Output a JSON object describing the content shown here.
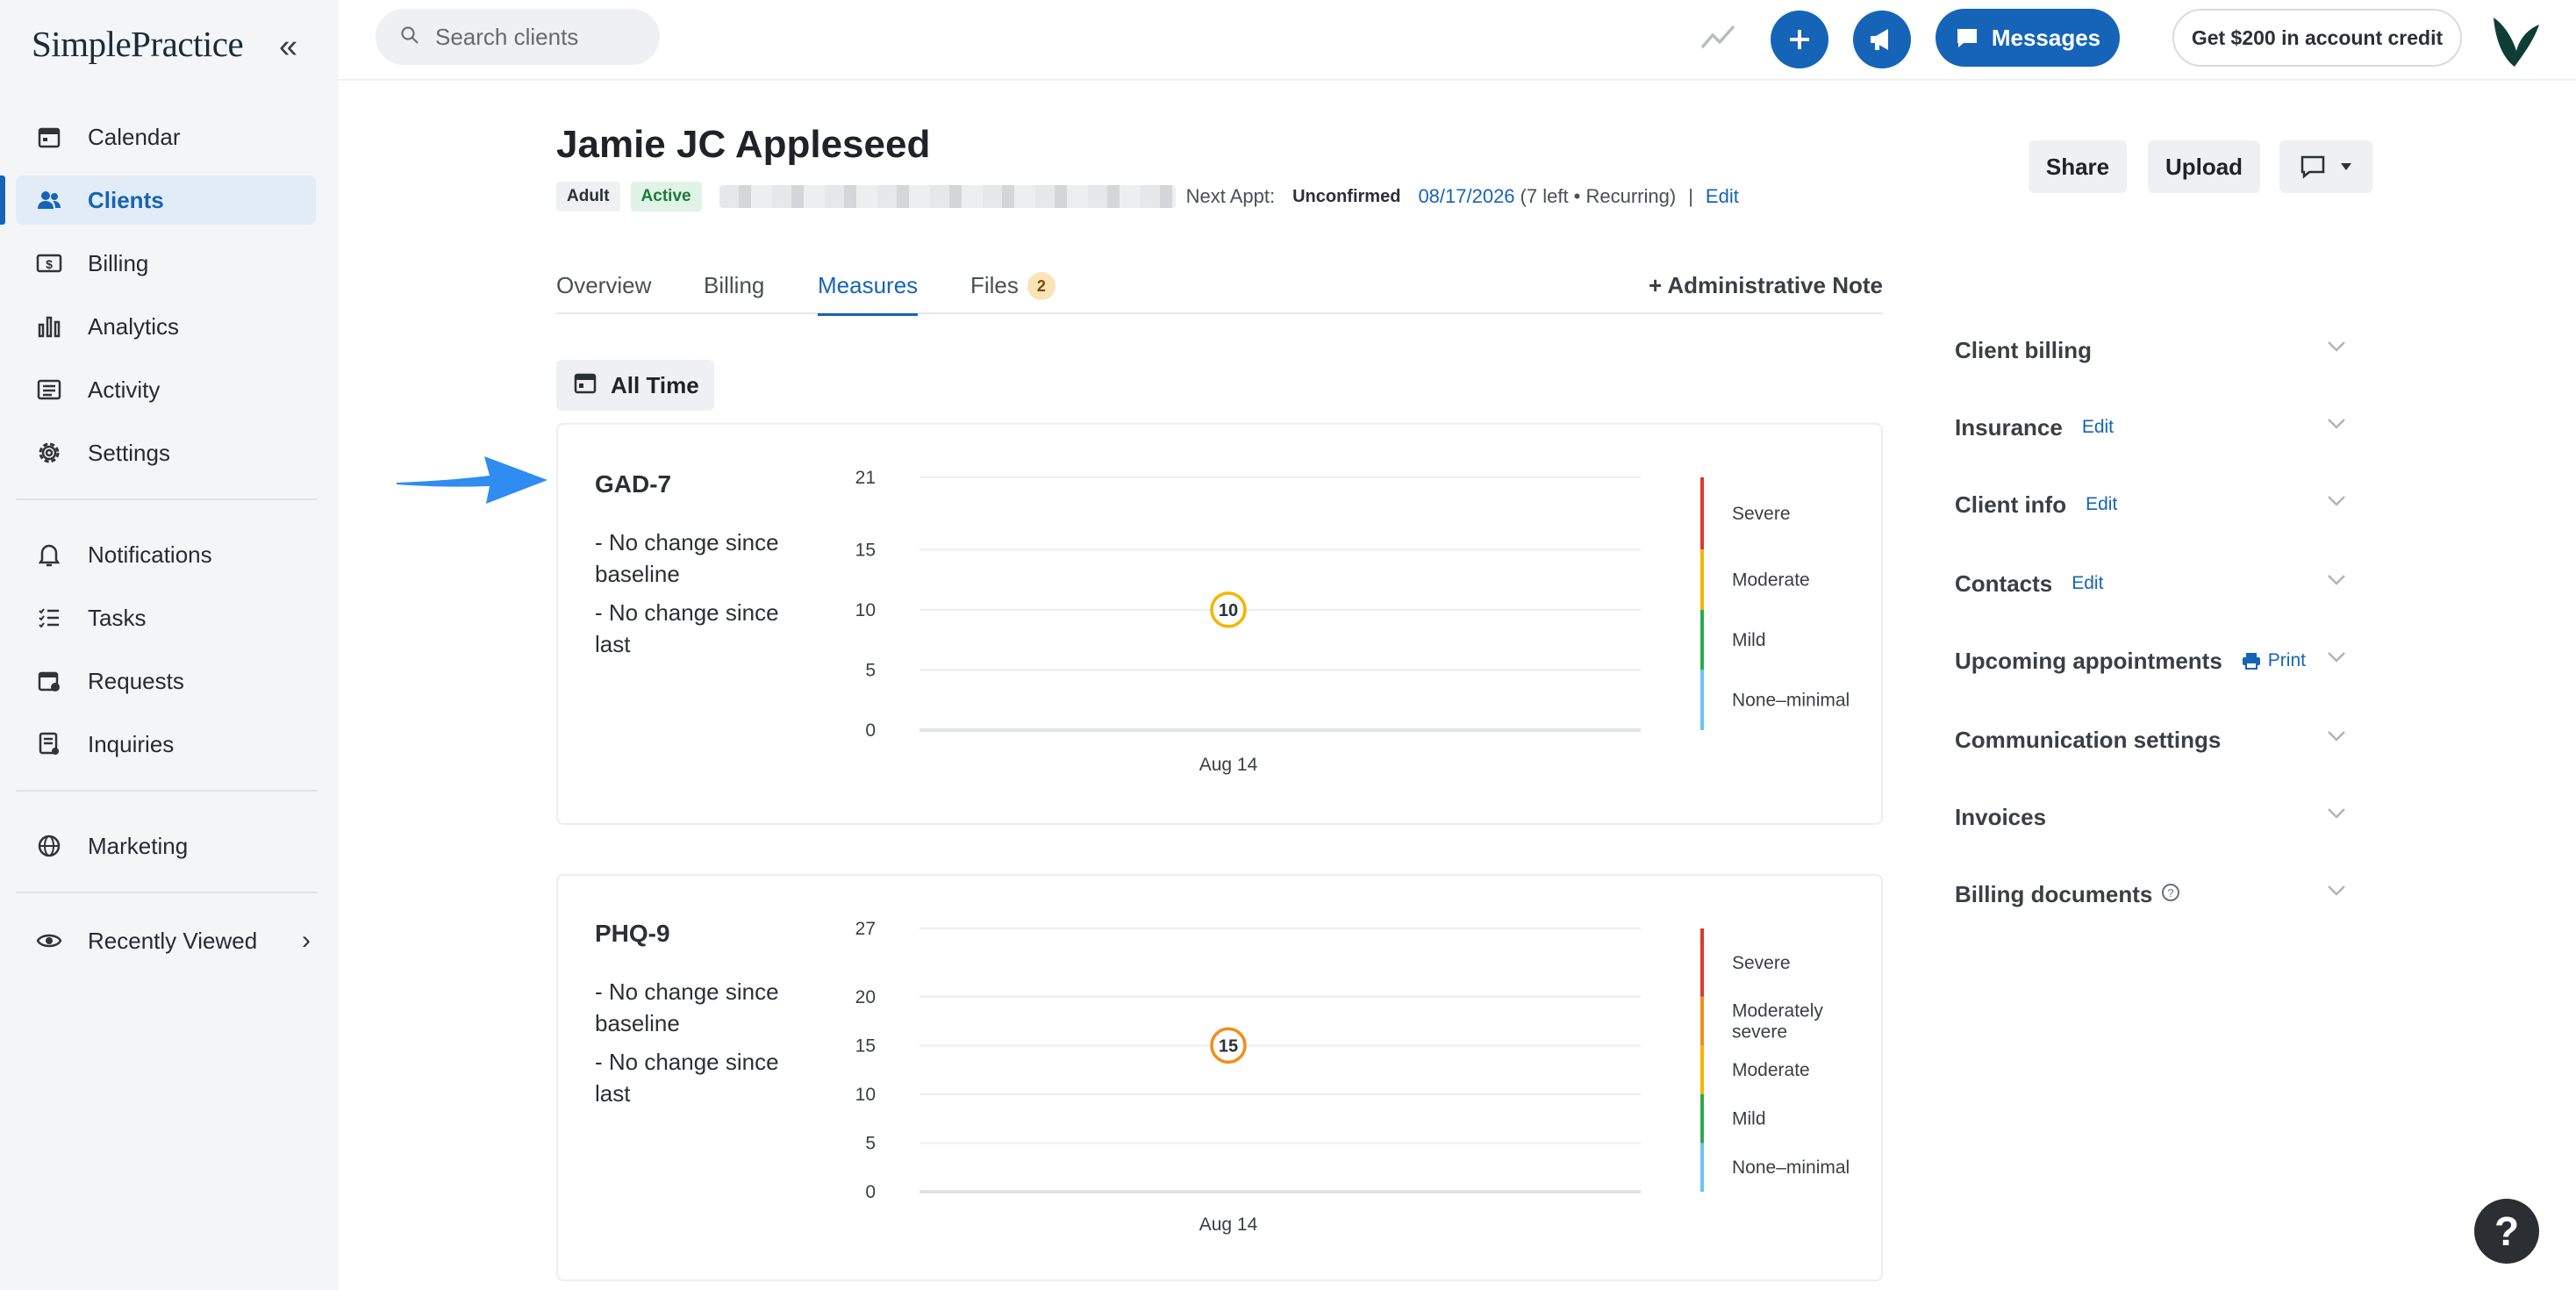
{
  "app": {
    "logo": "SimplePractice"
  },
  "sidebar": {
    "items": [
      {
        "label": "Calendar"
      },
      {
        "label": "Clients"
      },
      {
        "label": "Billing"
      },
      {
        "label": "Analytics"
      },
      {
        "label": "Activity"
      },
      {
        "label": "Settings"
      },
      {
        "label": "Notifications"
      },
      {
        "label": "Tasks"
      },
      {
        "label": "Requests"
      },
      {
        "label": "Inquiries"
      },
      {
        "label": "Marketing"
      },
      {
        "label": "Recently Viewed"
      }
    ],
    "active": "Clients"
  },
  "topbar": {
    "search_placeholder": "Search clients",
    "messages_label": "Messages",
    "credit_label": "Get $200 in account credit"
  },
  "client": {
    "name": "Jamie JC Appleseed",
    "badges": [
      "Adult",
      "Active"
    ],
    "next_appt_label": "Next Appt:",
    "appt_status": "Unconfirmed",
    "appt_date": "08/17/2026",
    "appt_detail": "(7 left • Recurring)",
    "separator": "|",
    "edit_label": "Edit"
  },
  "header_buttons": {
    "share": "Share",
    "upload": "Upload"
  },
  "tabs": [
    {
      "label": "Overview"
    },
    {
      "label": "Billing"
    },
    {
      "label": "Measures"
    },
    {
      "label": "Files",
      "count": "2"
    }
  ],
  "active_tab": "Measures",
  "admin_note_label": "+ Administrative Note",
  "time_filter": "All Time",
  "measures": [
    {
      "title": "GAD-7",
      "changes": [
        "- No change since baseline",
        "- No change since last"
      ],
      "y_ticks": [
        "21",
        "15",
        "10",
        "5",
        "0"
      ],
      "x_label": "Aug 14",
      "score": "10",
      "legend": [
        "Severe",
        "Moderate",
        "Mild",
        "None–minimal"
      ]
    },
    {
      "title": "PHQ-9",
      "changes": [
        "- No change since baseline",
        "- No change since last"
      ],
      "y_ticks": [
        "27",
        "20",
        "15",
        "10",
        "5",
        "0"
      ],
      "x_label": "Aug 14",
      "score": "15",
      "legend": [
        "Severe",
        "Moderately severe",
        "Moderate",
        "Mild",
        "None–minimal"
      ]
    }
  ],
  "chart_data": [
    {
      "type": "scatter",
      "title": "GAD-7",
      "x": [
        "Aug 14"
      ],
      "series": [
        {
          "values": [
            10
          ]
        }
      ],
      "ylim": [
        0,
        21
      ],
      "y_ticks": [
        0,
        5,
        10,
        15,
        21
      ],
      "bands": [
        {
          "label": "Severe",
          "range": [
            15,
            21
          ],
          "color": "#e0362c"
        },
        {
          "label": "Moderate",
          "range": [
            10,
            15
          ],
          "color": "#f5b400"
        },
        {
          "label": "Mild",
          "range": [
            5,
            10
          ],
          "color": "#2fa84f"
        },
        {
          "label": "None–minimal",
          "range": [
            0,
            5
          ],
          "color": "#6cc4f2"
        }
      ]
    },
    {
      "type": "scatter",
      "title": "PHQ-9",
      "x": [
        "Aug 14"
      ],
      "series": [
        {
          "values": [
            15
          ]
        }
      ],
      "ylim": [
        0,
        27
      ],
      "y_ticks": [
        0,
        5,
        10,
        15,
        20,
        27
      ],
      "bands": [
        {
          "label": "Severe",
          "range": [
            20,
            27
          ],
          "color": "#e0362c"
        },
        {
          "label": "Moderately severe",
          "range": [
            15,
            20
          ],
          "color": "#f28c1b"
        },
        {
          "label": "Moderate",
          "range": [
            10,
            15
          ],
          "color": "#f5b400"
        },
        {
          "label": "Mild",
          "range": [
            5,
            10
          ],
          "color": "#2fa84f"
        },
        {
          "label": "None–minimal",
          "range": [
            0,
            5
          ],
          "color": "#6cc4f2"
        }
      ]
    }
  ],
  "right_panel": [
    {
      "label": "Client billing"
    },
    {
      "label": "Insurance",
      "action": "Edit"
    },
    {
      "label": "Client info",
      "action": "Edit"
    },
    {
      "label": "Contacts",
      "action": "Edit"
    },
    {
      "label": "Upcoming appointments",
      "action": "Print"
    },
    {
      "label": "Communication settings"
    },
    {
      "label": "Invoices"
    },
    {
      "label": "Billing documents"
    }
  ],
  "help_label": "?"
}
